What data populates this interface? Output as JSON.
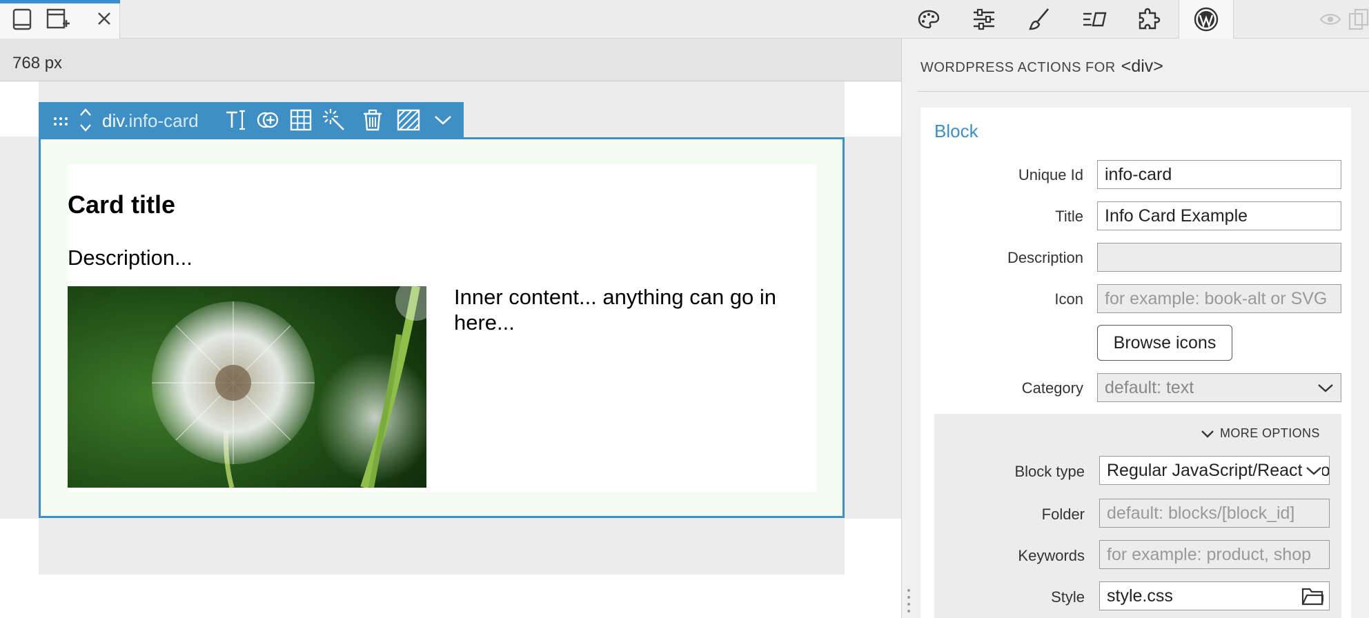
{
  "topbar": {
    "left_icons": [
      "tablet-icon",
      "add-page-icon",
      "close-icon"
    ],
    "right_icons": [
      "palette-icon",
      "sliders-icon",
      "brush-icon",
      "text-style-icon",
      "puzzle-icon",
      "wordpress-icon",
      "eye-icon",
      "window-icon"
    ]
  },
  "canvas": {
    "ruler_label": "768 px",
    "selection": {
      "element": "div",
      "class_name": ".info-card",
      "tools": [
        "text-cursor-icon",
        "add-circle-icon",
        "grid-icon",
        "magic-wand-icon",
        "trash-icon",
        "hatch-icon",
        "chevron-down-icon"
      ]
    },
    "card": {
      "title": "Card title",
      "description": "Description...",
      "content": "Inner content... anything can go in here..."
    }
  },
  "panel": {
    "header_prefix": "WORDPRESS ACTIONS FOR",
    "header_tag": "<div>",
    "block_title": "Block",
    "fields": {
      "unique_id": {
        "label": "Unique Id",
        "value": "info-card"
      },
      "title": {
        "label": "Title",
        "value": "Info Card Example"
      },
      "description": {
        "label": "Description",
        "value": ""
      },
      "icon": {
        "label": "Icon",
        "placeholder": "for example: book-alt or SVG"
      },
      "category": {
        "label": "Category",
        "value": "default: text"
      }
    },
    "browse_icons_label": "Browse icons",
    "more_options_label": "MORE OPTIONS",
    "more": {
      "block_type": {
        "label": "Block type",
        "value": "Regular JavaScript/React block"
      },
      "folder": {
        "label": "Folder",
        "placeholder": "default: blocks/[block_id]"
      },
      "keywords": {
        "label": "Keywords",
        "placeholder": "for example: product, shop"
      },
      "style": {
        "label": "Style",
        "value": "style.css"
      }
    }
  },
  "colors": {
    "accent": "#3d8fc6",
    "panel_bg": "#f0f0f0",
    "card_bg": "#f3fdf1"
  }
}
